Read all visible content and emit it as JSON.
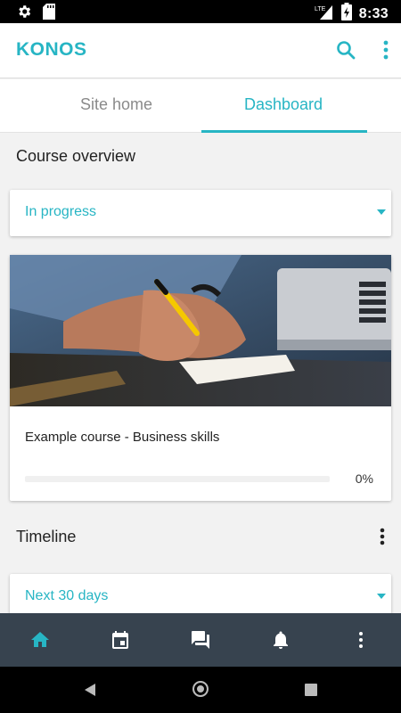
{
  "status_bar": {
    "time": "8:33",
    "network": "LTE"
  },
  "app": {
    "title": "KONOS",
    "accent": "#27b5c4"
  },
  "tabs": [
    {
      "label": "Site home",
      "active": false
    },
    {
      "label": "Dashboard",
      "active": true
    }
  ],
  "course_overview": {
    "title": "Course overview",
    "filter": "In progress",
    "courses": [
      {
        "name": "Example course - Business skills",
        "progress_percent": 0,
        "progress_text": "0%"
      }
    ]
  },
  "timeline": {
    "title": "Timeline",
    "filter": "Next 30 days"
  },
  "bottom_nav": {
    "items": [
      {
        "icon": "home-icon",
        "active": true
      },
      {
        "icon": "calendar-icon",
        "active": false
      },
      {
        "icon": "messages-icon",
        "active": false
      },
      {
        "icon": "notifications-icon",
        "active": false
      },
      {
        "icon": "more-icon",
        "active": false
      }
    ]
  }
}
